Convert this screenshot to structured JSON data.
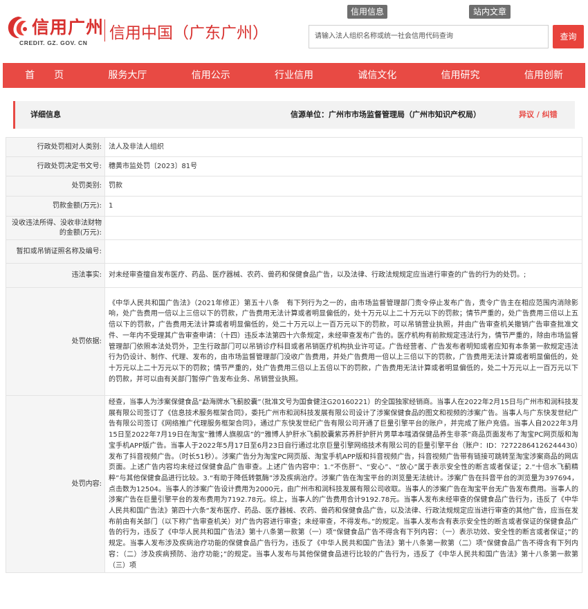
{
  "header": {
    "logo_text": "信用广州",
    "logo_sub": "CREDIT. GZ. GOV. CN",
    "site_title": "信用中国（广东广州）",
    "top_tabs": [
      "信用信息",
      "站内文章"
    ],
    "search_placeholder": "请输入法人组织名称或统一社会信用代码查询",
    "search_button": "查询"
  },
  "colors": {
    "brand_red": "#e84a44",
    "logo_red": "#d8312f"
  },
  "nav": [
    "首　　页",
    "服务大厅",
    "信用公示",
    "行业信用",
    "诚信文化",
    "信用研究",
    "信用创新"
  ],
  "source_bar": {
    "title": "详细信息",
    "unit": "信源单位：广州市市场监督管理局（广州市知识产权局）",
    "link": "异议 / 纠错"
  },
  "details": [
    {
      "label": "行政处罚相对人类别:",
      "value": "法人及非法人组织"
    },
    {
      "label": "行政处罚决定书文号:",
      "value": "穗黄市监处罚〔2023〕81号"
    },
    {
      "label": "处罚类别:",
      "value": "罚款"
    },
    {
      "label": "罚款金额(万元):",
      "value": "1"
    },
    {
      "label": "没收违法所得、没收非法财物的金额(万元):",
      "value": ""
    },
    {
      "label": "暂扣或吊销证照名称及编号:",
      "value": ""
    },
    {
      "label": "违法事实:",
      "value": "对未经审查擅自发布医疗、药品、医疗器械、农药、兽药和保健食品广告，以及法律、行政法规规定应当进行审查的广告的行为的处罚。;"
    },
    {
      "label": "处罚依据:",
      "value": "《中华人民共和国广告法》（2021年修正）第五十八条　有下列行为之一的，由市场监督管理部门责令停止发布广告，责令广告主在相应范围内消除影响，处广告费用一倍以上三倍以下的罚款，广告费用无法计算或者明显偏低的，处十万元以上二十万元以下的罚款；情节严重的，处广告费用三倍以上五倍以下的罚款，广告费用无法计算或者明显偏低的，处二十万元以上一百万元以下的罚款，可以吊销营业执照，并由广告审查机关撤销广告审查批准文件、一年内不受理其广告审查申请：（十四）违反本法第四十六条规定，未经审查发布广告的。医疗机构有前款规定违法行为，情节严重的，除由市场监督管理部门依照本法处罚外，卫生行政部门可以吊销诊疗科目或者吊销医疗机构执业许可证。广告经营者、广告发布者明知或者应知有本条第一款规定违法行为仍设计、制作、代理、发布的，由市场监督管理部门没收广告费用，并处广告费用一倍以上三倍以下的罚款，广告费用无法计算或者明显偏低的，处十万元以上二十万元以下的罚款；情节严重的，处广告费用三倍以上五倍以下的罚款，广告费用无法计算或者明显偏低的，处二十万元以上一百万元以下的罚款，并可以由有关部门暂停广告发布业务、吊销营业执照。"
    },
    {
      "label": "处罚内容:",
      "value": "经查，当事人为涉案保健食品“勐海牌水飞蓟胶囊”（批准文号为国食健注G20160221）的全国独家经销商。当事人在2022年2月15日与广州市和润科技发展有限公司签订了《信息技术服务框架合同》，委托广州市和润科技发展有限公司设计了涉案保健食品的图文和视频的涉案广告。当事人与广东快发世纪广告有限公司签订《网络推广代理服务框架合同》，通过广东快发世纪广告有限公司开通了巨量引擎平台的账户，并完成了账户充值。当事人自2022年3月15日至2022年7月19日在淘宝“雅博人旗舰店”的“雅博人护肝水飞蓟胶囊紫苏养肝护肝片男草本嗤酒保健品养生非茶”商品页面发布了淘宝PC网页版和淘宝手机APP版广告。当事人于2022年5月17日至6月23日自行通过北京巨量引擎网络技术有限公司的巨量引擎平台（账户：ID：?2722864126244430）发布了抖音视频广告。（时长51秒）。涉案广告分为淘宝PC网页版、淘宝手机APP版和抖音视频广告，抖音视频广告带有链接可跳转至淘宝涉案商品的网店页面。上述广告内容均未经过保健食品广告审查。上述广告内容中：1.“不伤肝”、“安心”、“放心”属于表示安全性的断言或者保证；2.“十倍水飞蓟精粹”与其他保健食品进行比较。3.“有助于降低转氨酶”涉及疾病治疗。涉案广告在淘宝平台的浏览量无法统计。涉案广告在抖音平台的浏览量为397694，点击数为12504。当事人的涉案广告设计费用为2000元，由广州市和润科技发展有限公司收取。当事人的涉案广告在淘宝平台无广告发布费用。当事人的涉案广告在巨量引擎平台的发布费用为7192.78元。综上，当事人的广告费用合计9192.78元。当事人发布未经审查的保健食品广告行为，违反了《中华人民共和国广告法》第四十六条“发布医疗、药品、医疗器械、农药、兽药和保健食品广告，以及法律、行政法规规定应当进行审查的其他广告，应当在发布前由有关部门（以下称广告审查机关）对广告内容进行审查；未经审查，不得发布。”的规定。当事人发布含有表示安全性的断言或者保证的保健食品广告的行为，违反了《中华人民共和国广告法》第十八条第一款第（一）项“保健食品广告不得含有下列内容：（一）表示功效、安全性的断言或者保证；”的规定。当事人发布涉及疾病治疗功能的保健食品广告行为，违反了《中华人民共和国广告法》第十八条第一款第（二）项“保健食品广告不得含有下列内容：（二）涉及疾病预防、治疗功能；”的规定。当事人发布与其他保健食品进行比较的广告行为，违反了《中华人民共和国广告法》第十八条第一款第（三）项"
    }
  ]
}
